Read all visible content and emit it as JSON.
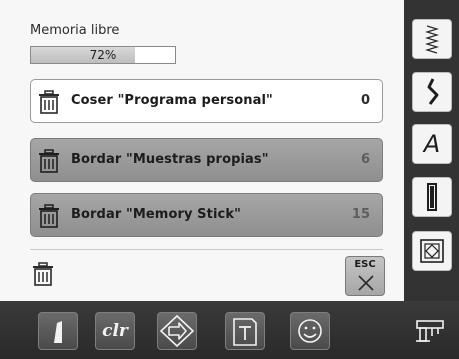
{
  "memory": {
    "label": "Memoria libre",
    "percent_text": "72%",
    "percent_value": 72
  },
  "rows": [
    {
      "label": "Coser \"Programa personal\"",
      "count": "0",
      "style": "selected"
    },
    {
      "label": "Bordar \"Muestras propias\"",
      "count": "6",
      "style": "normal"
    },
    {
      "label": "Bordar \"Memory Stick\"",
      "count": "15",
      "style": "normal"
    }
  ],
  "esc": {
    "label": "ESC"
  },
  "sidebar": {
    "items": [
      {
        "icon": "zigzag-stitch-icon"
      },
      {
        "icon": "decorative-stitch-icon"
      },
      {
        "icon": "alphabet-icon",
        "text": "A"
      },
      {
        "icon": "buttonhole-icon"
      },
      {
        "icon": "quilt-stitch-icon"
      },
      {
        "icon": "sewing-machine-icon"
      }
    ]
  },
  "toolbar": {
    "items": [
      {
        "icon": "needle-stop-icon"
      },
      {
        "icon": "clear-icon",
        "text": "clr"
      },
      {
        "icon": "pattern-start-icon"
      },
      {
        "icon": "folder-icon"
      },
      {
        "icon": "smiley-icon"
      }
    ]
  },
  "colors": {
    "panel_bg": "#f7f7f7",
    "row_selected_bg": "#ffffff",
    "row_normal_bg": "#999999",
    "dark_bg": "#333333"
  }
}
